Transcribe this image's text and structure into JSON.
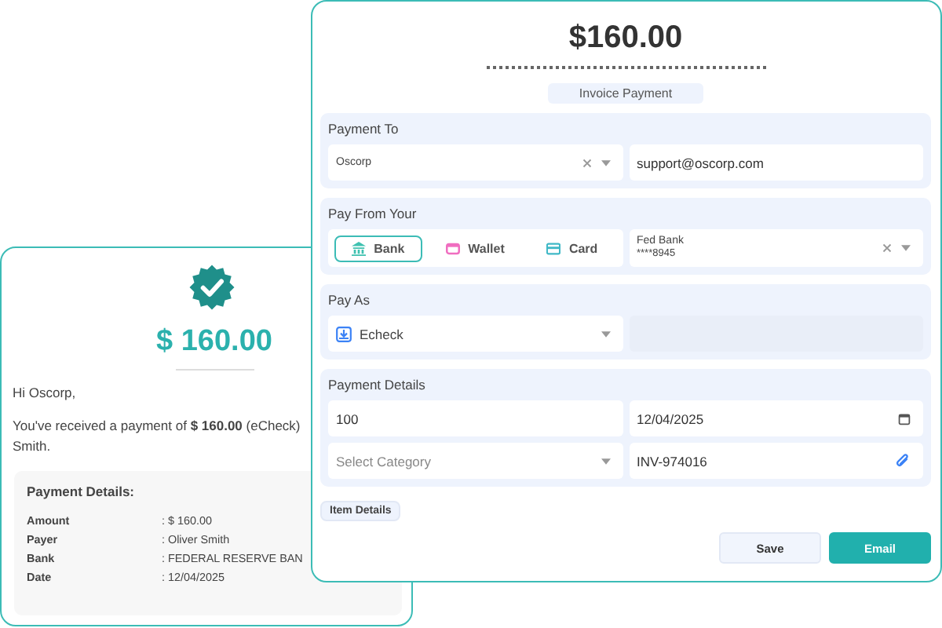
{
  "receipt": {
    "amount": "$ 160.00",
    "greeting": "Hi Oscorp,",
    "message": "You've received a payment of **$ 160.00** (eCheck)",
    "message_end": "Smith.",
    "details_title": "Payment Details:",
    "details": [
      {
        "label": "Amount",
        "value": ": $ 160.00"
      },
      {
        "label": "Payer",
        "value": ": Oliver Smith"
      },
      {
        "label": "Bank",
        "value": ": FEDERAL RESERVE BAN"
      },
      {
        "label": "Date",
        "value": ": 12/04/2025"
      }
    ]
  },
  "invoice": {
    "amount": "$160.00",
    "type": "Invoice Payment",
    "payment_to": {
      "label": "Payment To",
      "customer": "Oscorp",
      "email": "support@oscorp.com"
    },
    "pay_from": {
      "label": "Pay From Your",
      "methods": [
        {
          "label": "Bank",
          "kind": "bank",
          "selected": true,
          "color": "#3fc1b0"
        },
        {
          "label": "Wallet",
          "kind": "wallet",
          "selected": false,
          "color": "#f06ec0"
        },
        {
          "label": "Card",
          "kind": "card",
          "selected": false,
          "color": "#3fb8c6"
        }
      ],
      "account": {
        "name": "Fed Bank",
        "number": "****8945"
      }
    },
    "pay_as": {
      "label": "Pay As",
      "value": "Echeck"
    },
    "payment_details": {
      "label": "Payment Details",
      "amount": "100",
      "date": "12/04/2025",
      "category_placeholder": "Select Category",
      "invoice_number": "INV-974016"
    },
    "item_details": "Item Details",
    "buttons": [
      {
        "label": "Save",
        "kind": "secondary"
      },
      {
        "label": "Email",
        "kind": "primary"
      }
    ]
  }
}
